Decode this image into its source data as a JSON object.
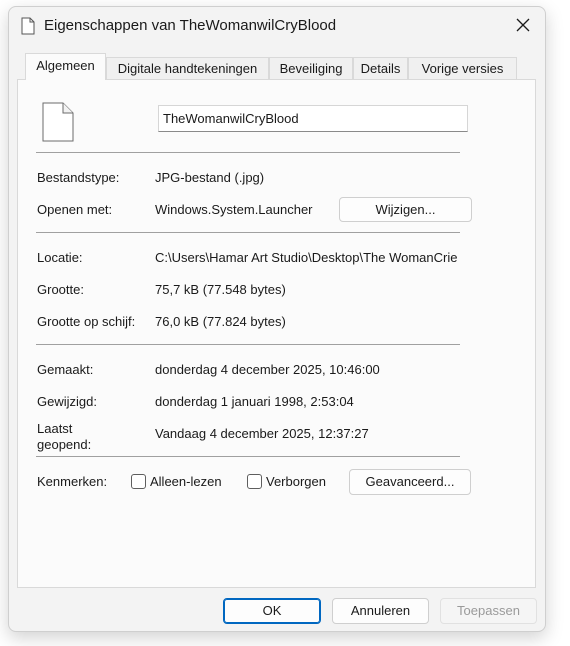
{
  "window": {
    "title": "Eigenschappen van TheWomanwilCryBlood",
    "title_icon": "document-icon",
    "close_icon": "close-icon"
  },
  "tabs": [
    {
      "label": "Algemeen",
      "active": true
    },
    {
      "label": "Digitale handtekeningen",
      "active": false
    },
    {
      "label": "Beveiliging",
      "active": false
    },
    {
      "label": "Details",
      "active": false
    },
    {
      "label": "Vorige versies",
      "active": false
    }
  ],
  "general": {
    "file_icon": "blank-file-icon",
    "file_name": "TheWomanwilCryBlood",
    "type_label": "Bestandstype:",
    "type_value": "JPG-bestand (.jpg)",
    "opens_label": "Openen met:",
    "opens_value": "Windows.System.Launcher",
    "change_button": "Wijzigen...",
    "location_label": "Locatie:",
    "location_value": "C:\\Users\\Hamar Art Studio\\Desktop\\The WomanCrie",
    "size_label": "Grootte:",
    "size_value": "75,7 kB (77.548 bytes)",
    "disk_size_label": "Grootte op schijf:",
    "disk_size_value": "76,0 kB (77.824 bytes)",
    "created_label": "Gemaakt:",
    "created_value": "donderdag 4 december 2025, 10:46:00",
    "modified_label": "Gewijzigd:",
    "modified_value": "donderdag 1 januari 1998, 2:53:04",
    "accessed_label_1": "Laatst",
    "accessed_label_2": "geopend:",
    "accessed_value": "Vandaag 4 december 2025, 12:37:27",
    "attributes_label": "Kenmerken:",
    "readonly_label": "Alleen-lezen",
    "readonly_checked": false,
    "hidden_label": "Verborgen",
    "hidden_checked": false,
    "advanced_button": "Geavanceerd..."
  },
  "footer": {
    "ok": "OK",
    "cancel": "Annuleren",
    "apply": "Toepassen"
  },
  "colors": {
    "accent": "#0067c0",
    "disabled_text": "#9a9a9a"
  }
}
